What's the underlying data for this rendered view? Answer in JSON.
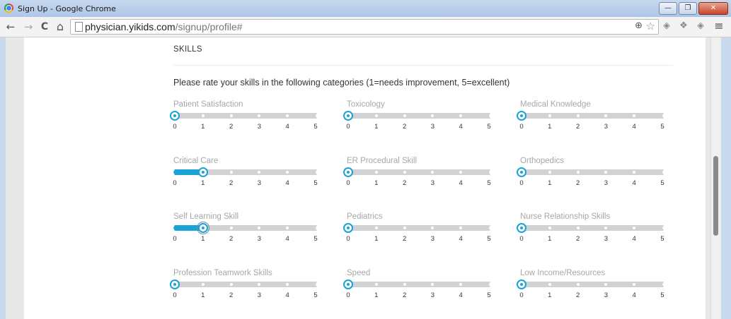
{
  "window": {
    "title": "Sign Up - Google Chrome",
    "minimize_label": "—",
    "restore_label": "❐",
    "close_label": "✕"
  },
  "toolbar": {
    "back_label": "←",
    "forward_label": "→",
    "reload_label": "C",
    "home_label": "⌂",
    "url_host": "physician.yikids.com",
    "url_path": "/signup/profile#",
    "zoom_label": "⊕",
    "star_label": "☆",
    "menu_label": "≡",
    "ext_icons": [
      "◈",
      "❖",
      "◈"
    ]
  },
  "section": {
    "heading": "SKILLS",
    "instructions": "Please rate your skills in the following categories (1=needs improvement, 5=excellent)"
  },
  "scale": {
    "min": 0,
    "max": 5,
    "ticks": [
      "0",
      "1",
      "2",
      "3",
      "4",
      "5"
    ]
  },
  "accent_color": "#1aa3d6",
  "track_color": "#d0d2d4",
  "skills": [
    {
      "label": "Patient Satisfaction",
      "value": 0,
      "focused": false
    },
    {
      "label": "Toxicology",
      "value": 0,
      "focused": false
    },
    {
      "label": "Medical Knowledge",
      "value": 0,
      "focused": false
    },
    {
      "label": "Critical Care",
      "value": 1,
      "focused": false
    },
    {
      "label": "ER Procedural Skill",
      "value": 0,
      "focused": false
    },
    {
      "label": "Orthopedics",
      "value": 0,
      "focused": false
    },
    {
      "label": "Self Learning Skill",
      "value": 1,
      "focused": true
    },
    {
      "label": "Pediatrics",
      "value": 0,
      "focused": false
    },
    {
      "label": "Nurse Relationship Skills",
      "value": 0,
      "focused": false
    },
    {
      "label": "Profession Teamwork Skills",
      "value": 0,
      "focused": false
    },
    {
      "label": "Speed",
      "value": 0,
      "focused": false
    },
    {
      "label": "Low Income/Resources",
      "value": 0,
      "focused": false
    }
  ]
}
